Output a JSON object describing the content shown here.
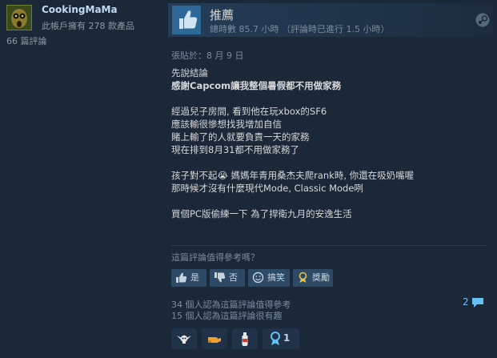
{
  "author": {
    "name": "CookingMaMa",
    "products_owned": "此帳戶擁有 278 款產品",
    "review_count": "66 篇評論"
  },
  "review": {
    "verdict": "推薦",
    "hours": "總時數 85.7 小時 （評論時已進行 1.5 小時）",
    "posted": "張貼於：8 月 9 日",
    "paragraphs": [
      {
        "lines": [
          "先說結論",
          "感謝Capcom讓我整個暑假都不用做家務"
        ]
      },
      {
        "lines": [
          "經過兒子房間, 看到他在玩xbox的SF6",
          "應該輸很慘想找我增加自信",
          "賭上輸了的人就要負責一天的家務",
          "現在排到8月31都不用做家務了"
        ]
      },
      {
        "lines": [
          "孩子對不起😭 媽媽年青用桑杰夫爬rank時, 你還在吸奶嘴喔",
          "那時候才沒有什麼現代Mode, Classic Mode咧"
        ]
      },
      {
        "lines": [
          "買個PC版偷練一下 為了捍衛九月的安逸生活"
        ]
      }
    ]
  },
  "helpful": {
    "question": "這篇評論值得參考嗎？",
    "buttons": {
      "yes": "是",
      "no": "否",
      "funny": "搞笑",
      "award": "獎勵"
    }
  },
  "stats": {
    "helpful_count": "34 個人認為這篇評論值得參考",
    "funny_count": "15 個人認為這篇評論很有趣"
  },
  "comments": {
    "count": "2"
  },
  "awards": {
    "items": [
      {
        "icon": "winged-skull-icon"
      },
      {
        "icon": "golden-hand-icon"
      },
      {
        "icon": "hot-sauce-icon"
      },
      {
        "icon": "ribbon-medal-icon",
        "count": "1"
      }
    ]
  },
  "colors": {
    "background": "#1b2838",
    "accent_blue": "#66c0f4",
    "button_bg": "#2c4a66",
    "thumb_box": "#2e6896"
  }
}
